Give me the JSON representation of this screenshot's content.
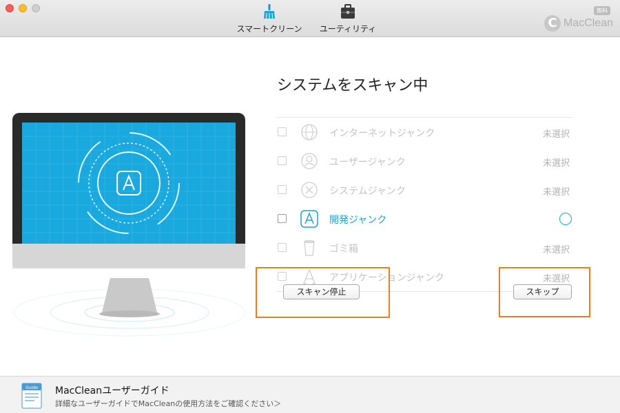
{
  "toolbar": {
    "smart_clean_label": "スマートクリーン",
    "utility_label": "ユーティリティ",
    "brand_name": "MacClean",
    "brand_letter": "C",
    "free_badge": "無料",
    "smart_clean_icon": "broom-icon",
    "utility_icon": "toolbox-icon"
  },
  "main": {
    "title": "システムをスキャン中",
    "items": [
      {
        "label": "インターネットジャンク",
        "status": "未選択",
        "icon": "globe-icon",
        "active": false
      },
      {
        "label": "ユーザージャンク",
        "status": "未選択",
        "icon": "user-icon",
        "active": false
      },
      {
        "label": "システムジャンク",
        "status": "未選択",
        "icon": "close-circle-icon",
        "active": false
      },
      {
        "label": "開発ジャンク",
        "status": "",
        "icon": "app-store-icon",
        "active": true
      },
      {
        "label": "ゴミ箱",
        "status": "未選択",
        "icon": "trash-icon",
        "active": false
      },
      {
        "label": "アプリケーションジャンク",
        "status": "未選択",
        "icon": "app-icon",
        "active": false
      }
    ],
    "stop_button": "スキャン停止",
    "skip_button": "スキップ"
  },
  "guide": {
    "title": "MacCleanユーザーガイド",
    "subtitle": "詳細なユーザーガイドでMacCleanの使用方法をご確認ください＞",
    "icon_label": "Guide"
  },
  "colors": {
    "accent": "#1aa5d4",
    "highlight": "#f27a1c"
  }
}
